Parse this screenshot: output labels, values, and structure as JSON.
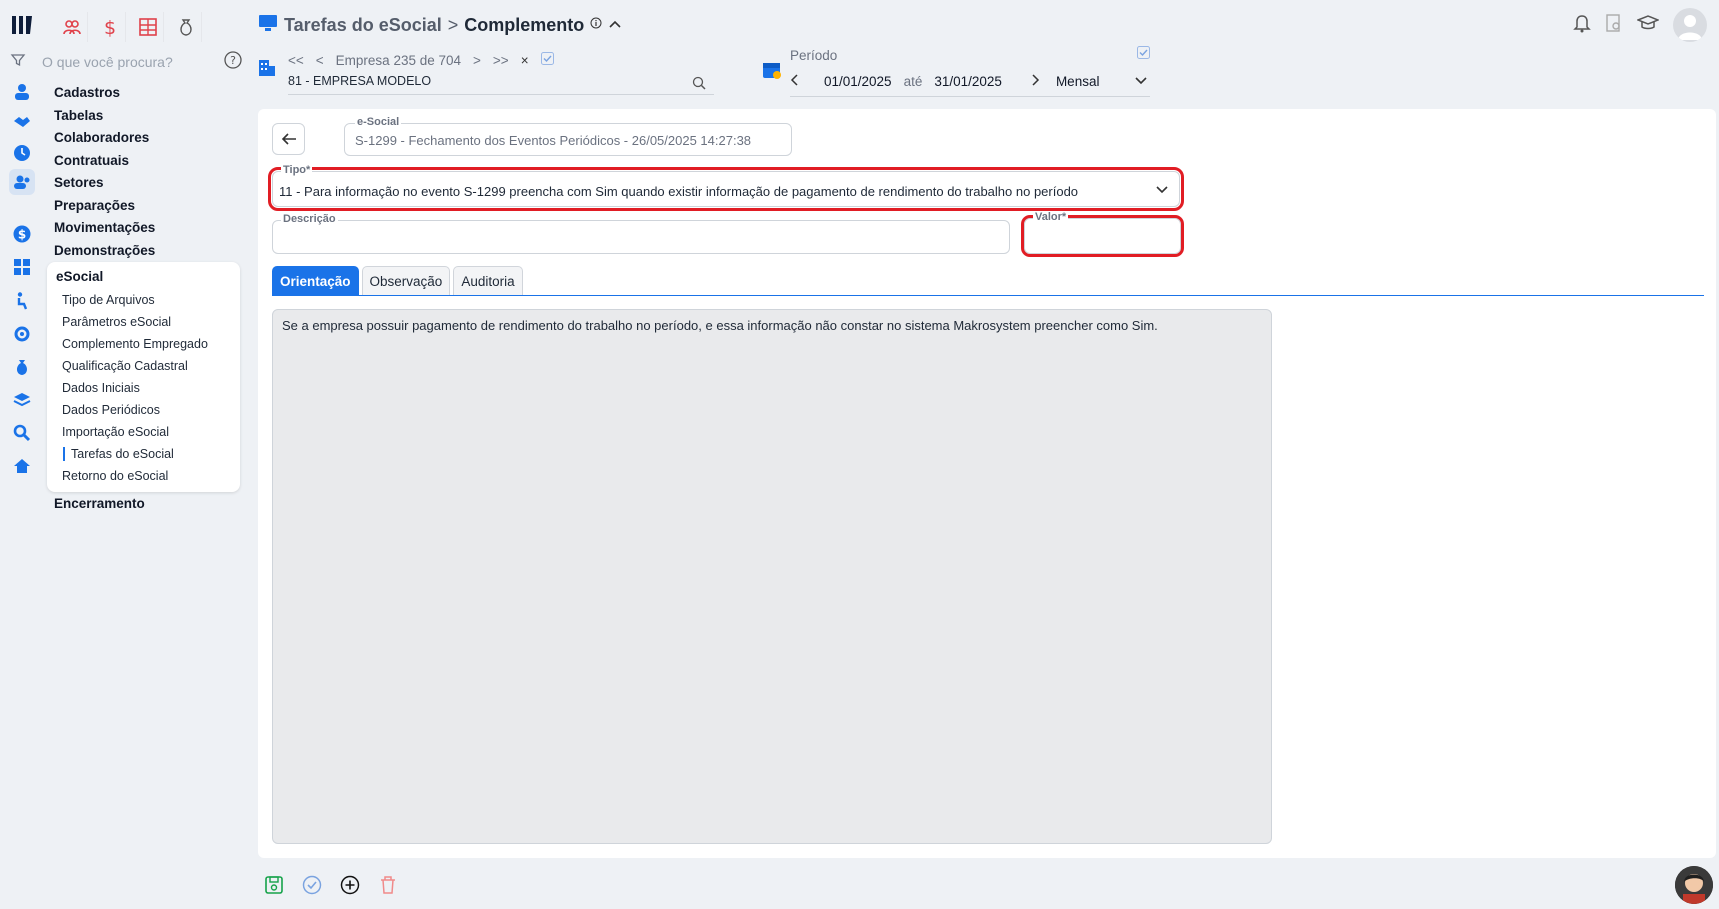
{
  "header": {
    "breadcrumb_parent": "Tarefas do eSocial",
    "breadcrumb_separator": ">",
    "breadcrumb_current": "Complemento"
  },
  "sidebar": {
    "search_placeholder": "O que você procura?",
    "menu": [
      "Cadastros",
      "Tabelas",
      "Colaboradores",
      "Contratuais",
      "Setores",
      "Preparações",
      "Movimentações",
      "Demonstrações"
    ],
    "group": {
      "title": "eSocial",
      "items": [
        "Tipo de Arquivos",
        "Parâmetros eSocial",
        "Complemento Empregado",
        "Qualificação Cadastral",
        "Dados Iniciais",
        "Dados Periódicos",
        "Importação eSocial",
        "Tarefas do eSocial",
        "Retorno do eSocial"
      ],
      "selected": "Tarefas do eSocial"
    },
    "last_item": "Encerramento"
  },
  "empresa": {
    "first": "<<",
    "prev": "<",
    "label": "Empresa 235 de 704",
    "next": ">",
    "last": ">>",
    "close": "×",
    "value": "81 - EMPRESA MODELO"
  },
  "periodo": {
    "label": "Período",
    "from": "01/01/2025",
    "to_label": "até",
    "to": "31/01/2025",
    "frequency": "Mensal"
  },
  "form": {
    "esocial_label": "e-Social",
    "esocial_value": "S-1299 - Fechamento dos Eventos Periódicos - 26/05/2025 14:27:38",
    "tipo_label": "Tipo*",
    "tipo_value": "11 - Para informação no evento S-1299 preencha com Sim quando existir informação de pagamento de rendimento do trabalho no período",
    "descricao_label": "Descrição",
    "descricao_value": "",
    "valor_label": "Valor*",
    "valor_value": ""
  },
  "tabs": [
    "Orientação",
    "Observação",
    "Auditoria"
  ],
  "orientacao_text": "Se a empresa possuir pagamento de rendimento do trabalho no período, e essa informação não constar no sistema Makrosystem preencher como Sim.",
  "colors": {
    "accent": "#1a73e8",
    "highlight": "#e11d24",
    "danger_icon": "#e0424b"
  }
}
